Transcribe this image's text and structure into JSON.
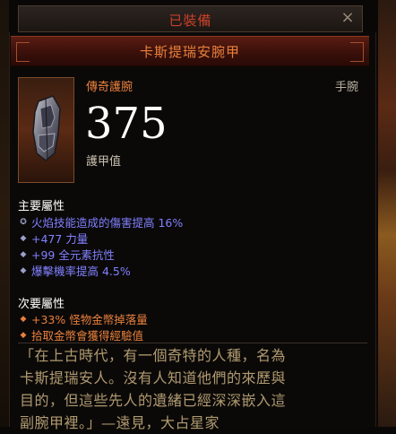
{
  "header": {
    "title": "已裝備",
    "close_label": "×"
  },
  "item": {
    "name": "卡斯提瑞安腕甲",
    "rarity_type": "傳奇護腕",
    "slot": "手腕",
    "armor_value": "375",
    "armor_label": "護甲值"
  },
  "primary": {
    "heading": "主要屬性",
    "affixes": [
      "火焰技能造成的傷害提高 16%",
      "+477 力量",
      "+99 全元素抗性",
      "爆擊機率提高 4.5%"
    ]
  },
  "secondary": {
    "heading": "次要屬性",
    "affixes": [
      "+33% 怪物金幣掉落量",
      "拾取金幣會獲得經驗值"
    ]
  },
  "lore": {
    "lines": [
      "「在上古時代，有一個奇特的人種，名為",
      "卡斯提瑞安人。沒有人知道他們的來歷與",
      "目的，但這些先人的遺緒已經深深嵌入這",
      "副腕甲裡。」—遠見，大占星家"
    ]
  },
  "colors": {
    "legendary": "#e8803c",
    "magic_affix": "#8080ff",
    "header_red": "#c8402a",
    "lore": "#b09a70"
  }
}
